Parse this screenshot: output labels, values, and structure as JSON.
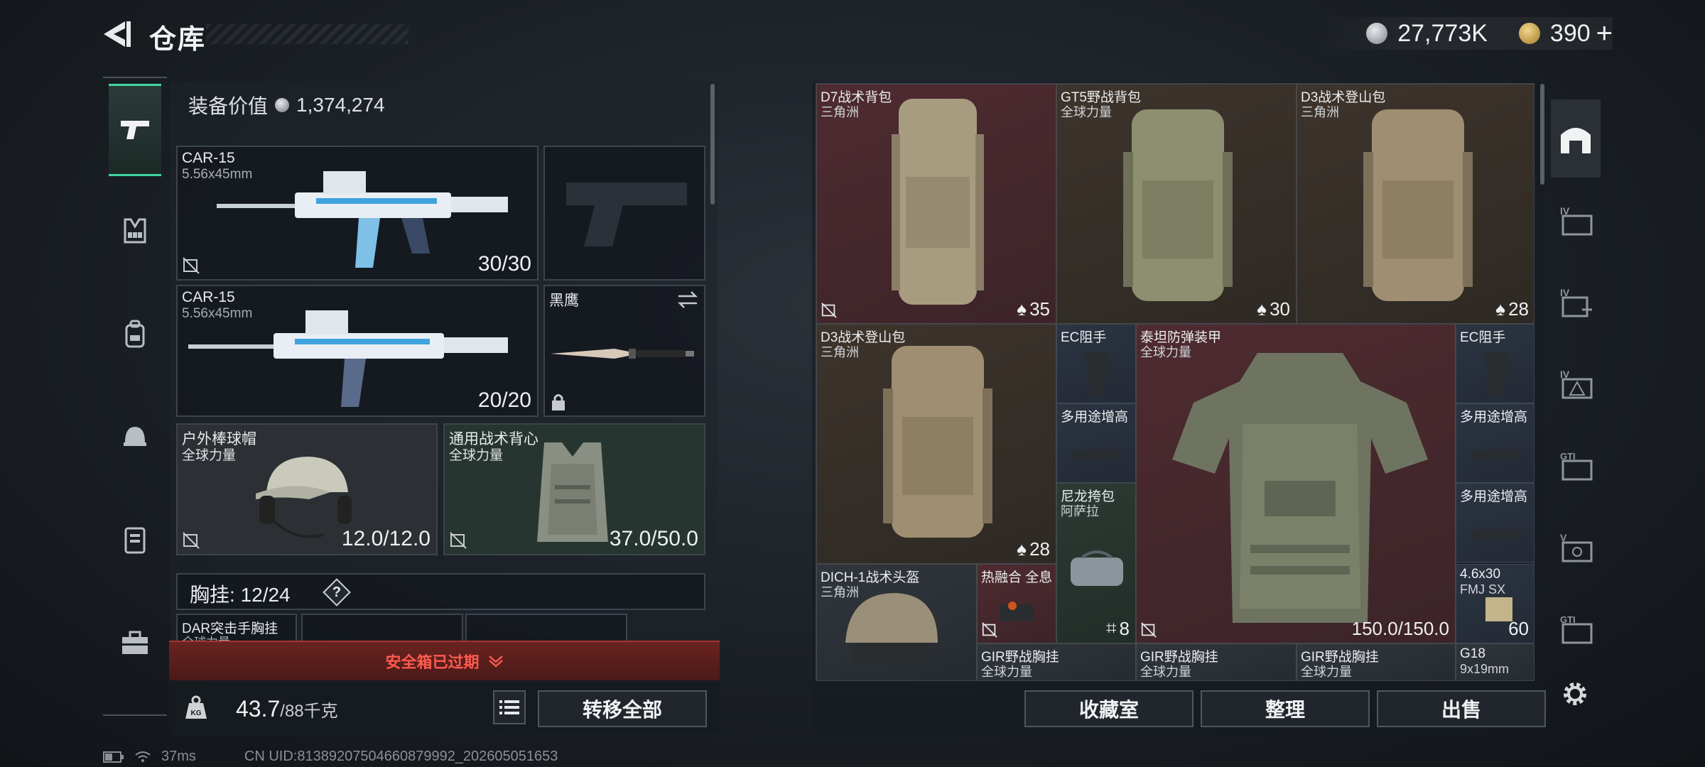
{
  "header": {
    "title": "仓库",
    "currency": [
      {
        "icon": "silver-coin-icon",
        "value": "27,773K"
      },
      {
        "icon": "gold-coin-icon",
        "value": "390",
        "suffix": "+"
      }
    ]
  },
  "categories": [
    {
      "icon": "pistol-icon",
      "active": true
    },
    {
      "icon": "chest-rig-icon"
    },
    {
      "icon": "backpack-icon"
    },
    {
      "icon": "helmet-icon"
    },
    {
      "icon": "armor-icon"
    },
    {
      "icon": "toolbox-icon"
    }
  ],
  "loadout": {
    "equipment_value_label": "装备价值",
    "equipment_value": "1,374,274",
    "primary1": {
      "name": "CAR-15",
      "caliber": "5.56x45mm",
      "ammo": "30/30"
    },
    "primary2": {
      "name": "CAR-15",
      "caliber": "5.56x45mm",
      "ammo": "20/20"
    },
    "melee": {
      "name": "黑鹰"
    },
    "helmet": {
      "name": "户外棒球帽",
      "faction": "全球力量",
      "durability": "12.0/12.0"
    },
    "armor": {
      "name": "通用战术背心",
      "faction": "全球力量",
      "durability": "37.0/50.0"
    },
    "chest_rig": {
      "label": "胸挂:",
      "capacity": "12/24",
      "help": "?"
    },
    "rig_item": {
      "name": "DAR突击手胸挂",
      "faction": "全球力量"
    },
    "safe_box": "安全箱已过期",
    "weight": {
      "current": "43.7",
      "max": "/88千克"
    },
    "weight_icon_label": "KG",
    "transfer_all": "转移全部"
  },
  "storage": {
    "items": [
      {
        "name": "D7战术背包",
        "sub": "三角洲",
        "count": "35"
      },
      {
        "name": "GT5野战背包",
        "sub": "全球力量",
        "count": "30"
      },
      {
        "name": "D3战术登山包",
        "sub": "三角洲",
        "count": "28"
      },
      {
        "name": "D3战术登山包",
        "sub": "三角洲",
        "count": "28"
      },
      {
        "name": "EC阻手"
      },
      {
        "name": "泰坦防弹装甲",
        "sub": "全球力量",
        "count": "150.0/150.0"
      },
      {
        "name": "EC阻手"
      },
      {
        "name": "多用途增高"
      },
      {
        "name": "多用途增高"
      },
      {
        "name": "尼龙挎包",
        "sub": "阿萨拉",
        "count": "8"
      },
      {
        "name": "多用途增高"
      },
      {
        "name": "DICH-1战术头盔",
        "sub": "三角洲"
      },
      {
        "name": "热融合 全息"
      },
      {
        "name": "4.6x30",
        "sub": "FMJ SX",
        "count": "60"
      },
      {
        "name": "GIR野战胸挂",
        "sub": "全球力量"
      },
      {
        "name": "GIR野战胸挂",
        "sub": "全球力量"
      },
      {
        "name": "GIR野战胸挂",
        "sub": "全球力量"
      },
      {
        "name": "G18",
        "sub": "9x19mm"
      }
    ],
    "buttons": {
      "collection": "收藏室",
      "organize": "整理",
      "sell": "出售"
    }
  },
  "status_bar": {
    "ping": "37ms",
    "uid": "CN UID:8138920750466087999​2_202605051653"
  },
  "colors": {
    "accent": "#3fd6a3",
    "warning": "#ff5a4e"
  }
}
